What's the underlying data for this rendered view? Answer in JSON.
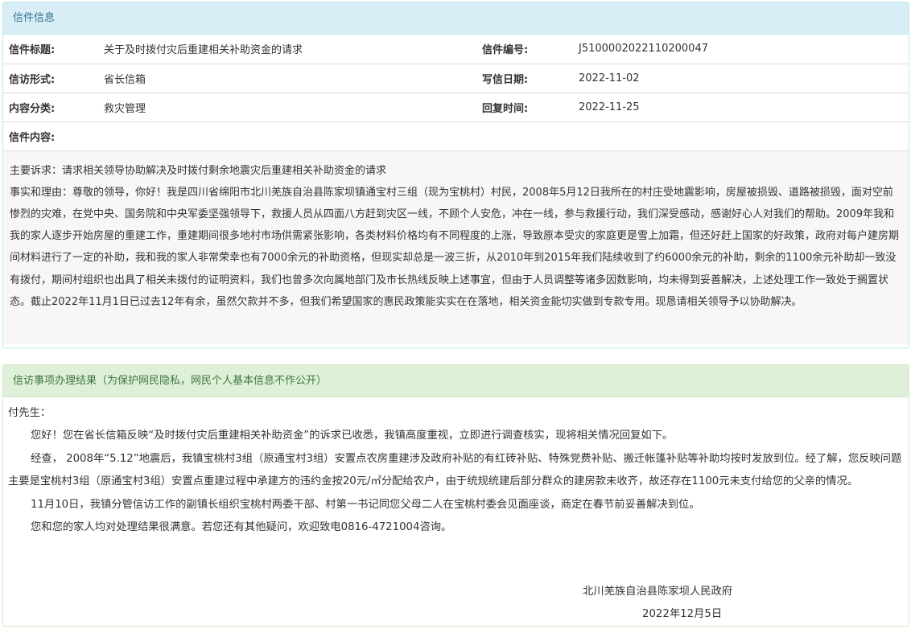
{
  "letter": {
    "heading": "信件信息",
    "rows": [
      {
        "label1": "信件标题:",
        "value1": "关于及时拨付灾后重建相关补助资金的请求",
        "label2": "信件编号:",
        "value2": "J5100002022110200047"
      },
      {
        "label1": "信访形式:",
        "value1": "省长信箱",
        "label2": "写信日期:",
        "value2": "2022-11-02"
      },
      {
        "label1": "内容分类:",
        "value1": "救灾管理",
        "label2": "回复时间:",
        "value2": "2022-11-25"
      }
    ],
    "content_label": "信件内容:",
    "content_paragraphs": [
      "主要诉求：请求相关领导协助解决及时拨付剩余地震灾后重建相关补助资金的请求",
      "事实和理由：尊敬的领导，你好！我是四川省绵阳市北川羌族自治县陈家坝镇通宝村三组（现为宝桃村）村民，2008年5月12日我所在的村庄受地震影响，房屋被损毁、道路被损毁，面对空前惨烈的灾难，在党中央、国务院和中央军委坚强领导下，救援人员从四面八方赶到灾区一线，不顾个人安危，冲在一线，参与救援行动，我们深受感动，感谢好心人对我们的帮助。2009年我和我的家人逐步开始房屋的重建工作，重建期间很多地村市场供需紧张影响，各类材料价格均有不同程度的上涨，导致原本受灾的家庭更是雪上加霜，但还好赶上国家的好政策，政府对每户建房期间材料进行了一定的补助，我和我的家人非常荣幸也有7000余元的补助资格，但现实却总是一波三折，从2010年到2015年我们陆续收到了约6000余元的补助，剩余的1100余元补助却一致没有拨付，期间村组织也出具了相关未拨付的证明资料，我们也曾多次向属地部门及市长热线反映上述事宜，但由于人员调整等诸多因数影响，均未得到妥善解决，上述处理工作一致处于搁置状态。截止2022年11月1日已过去12年有余，虽然欠款并不多，但我们希望国家的惠民政策能实实在在落地，相关资金能切实做到专款专用。现恳请相关领导予以协助解决。"
    ]
  },
  "result": {
    "heading": "信访事项办理结果（为保护网民隐私，网民个人基本信息不作公开）",
    "greeting": "付先生：",
    "paragraphs": [
      "您好！您在省长信箱反映“及时拨付灾后重建相关补助资金”的诉求已收悉，我镇高度重视，立即进行调查核实，现将相关情况回复如下。",
      "经查， 2008年“5.12”地震后，我镇宝桃村3组（原通宝村3组）安置点农房重建涉及政府补贴的有红砖补贴、特殊党费补贴、搬迁帐篷补贴等补助均按时发放到位。经了解，您反映问题主要是宝桃村3组（原通宝村3组）安置点重建过程中承建方的违约金按20元/㎡分配给农户，由于统规统建后部分群众的建房款未收齐，故还存在1100元未支付给您的父亲的情况。",
      "11月10日，我镇分管信访工作的副镇长组织宝桃村两委干部、村第一书记同您父母二人在宝桃村委会见面座谈，商定在春节前妥善解决到位。",
      "您和您的家人均对处理结果很满意。若您还有其他疑问，欢迎致电0816-4721004咨询。"
    ],
    "signature_org": "北川羌族自治县陈家坝人民政府",
    "signature_date": "2022年12月5日"
  }
}
